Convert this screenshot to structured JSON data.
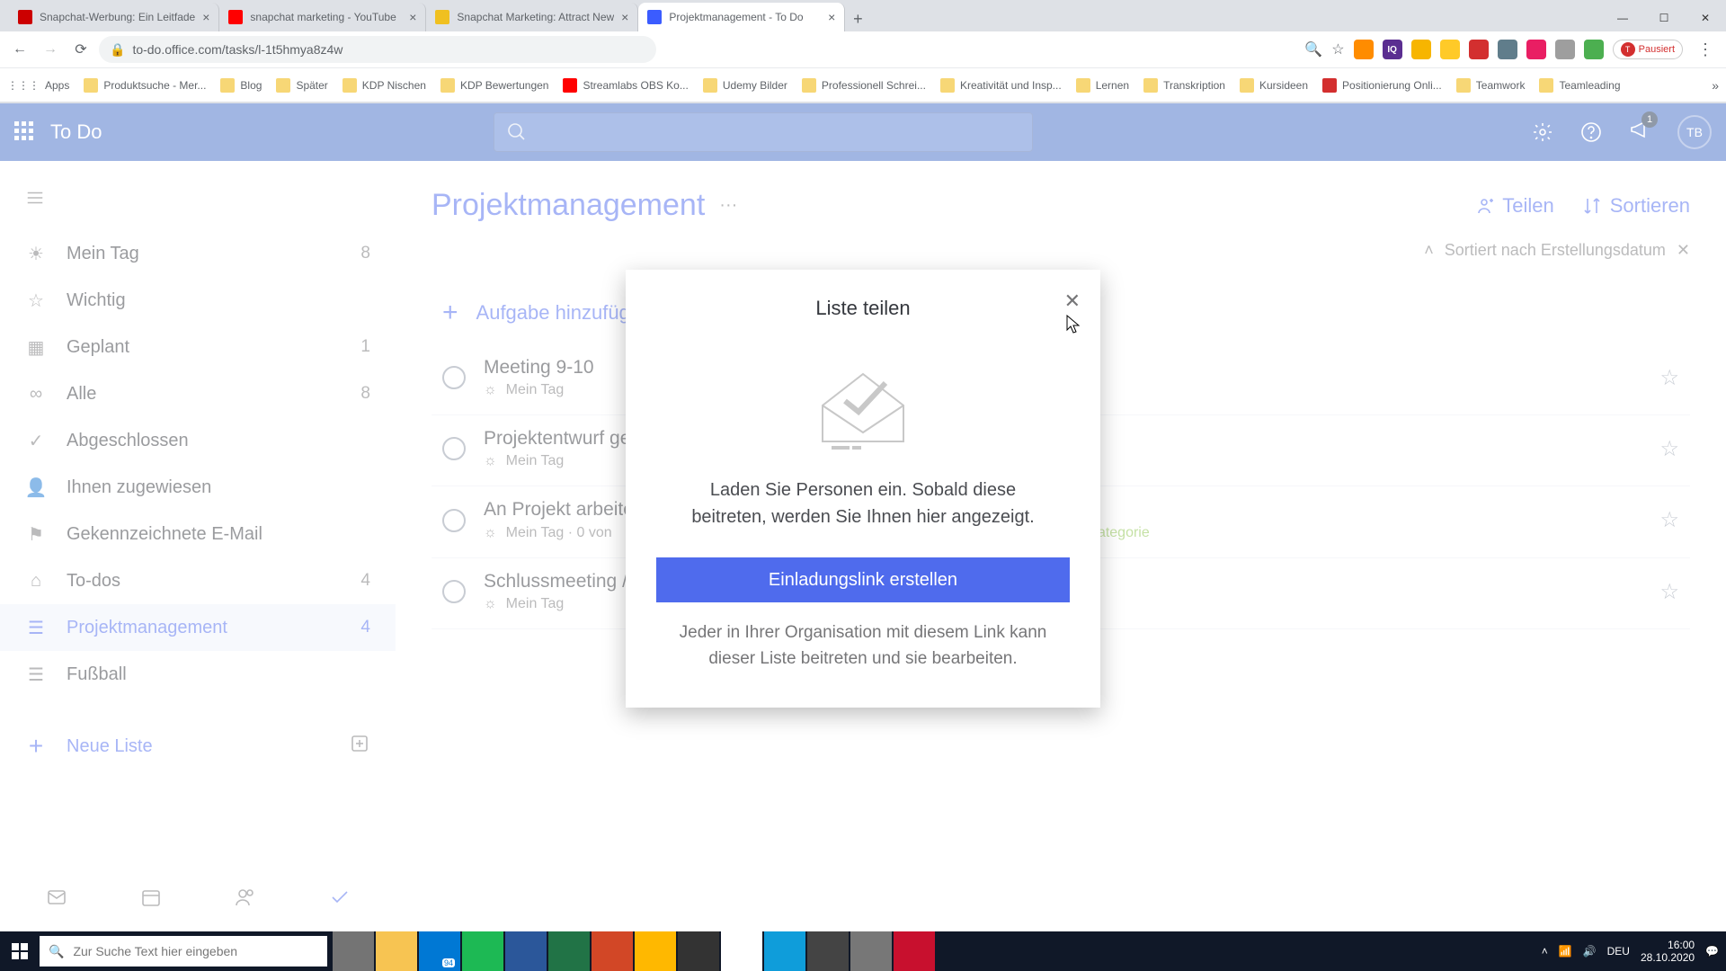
{
  "browser": {
    "tabs": [
      {
        "title": "Snapchat-Werbung: Ein Leitfade"
      },
      {
        "title": "snapchat marketing - YouTube"
      },
      {
        "title": "Snapchat Marketing: Attract New"
      },
      {
        "title": "Projektmanagement - To Do"
      }
    ],
    "url": "to-do.office.com/tasks/l-1t5hmya8z4w",
    "pause_label": "Pausiert",
    "bookmarks": [
      "Apps",
      "Produktsuche - Mer...",
      "Blog",
      "Später",
      "KDP Nischen",
      "KDP Bewertungen",
      "Streamlabs OBS Ko...",
      "Udemy Bilder",
      "Professionell Schrei...",
      "Kreativität und Insp...",
      "Lernen",
      "Transkription",
      "Kursideen",
      "Positionierung Onli...",
      "Teamwork",
      "Teamleading"
    ]
  },
  "app": {
    "title": "To Do",
    "avatar": "TB",
    "notification_count": 1
  },
  "sidebar": {
    "items": [
      {
        "label": "Mein Tag",
        "count": 8
      },
      {
        "label": "Wichtig",
        "count": ""
      },
      {
        "label": "Geplant",
        "count": 1
      },
      {
        "label": "Alle",
        "count": 8
      },
      {
        "label": "Abgeschlossen",
        "count": ""
      },
      {
        "label": "Ihnen zugewiesen",
        "count": ""
      },
      {
        "label": "Gekennzeichnete E-Mail",
        "count": ""
      },
      {
        "label": "To-dos",
        "count": 4
      },
      {
        "label": "Projektmanagement",
        "count": 4
      },
      {
        "label": "Fußball",
        "count": ""
      }
    ],
    "new_list": "Neue Liste"
  },
  "main": {
    "title": "Projektmanagement",
    "share": "Teilen",
    "sort": "Sortieren",
    "sort_label": "Sortiert nach Erstellungsdatum",
    "add_task": "Aufgabe hinzufüg",
    "tasks": [
      {
        "title": "Meeting 9-10",
        "meta": "Mein Tag",
        "extra": ""
      },
      {
        "title": "Projektentwurf ge",
        "meta": "Mein Tag",
        "extra": ""
      },
      {
        "title": "An Projekt arbeite",
        "meta": "Mein Tag  ·  0 von",
        "extra": "üne Kategorie"
      },
      {
        "title": "Schlussmeeting //",
        "meta": "Mein Tag",
        "extra": ""
      }
    ]
  },
  "dialog": {
    "title": "Liste teilen",
    "body": "Laden Sie Personen ein. Sobald diese beitreten, werden Sie Ihnen hier angezeigt.",
    "button": "Einladungslink erstellen",
    "footer": "Jeder in Ihrer Organisation mit diesem Link kann dieser Liste beitreten und sie bearbeiten."
  },
  "taskbar": {
    "search_placeholder": "Zur Suche Text hier eingeben",
    "mail_badge": "94",
    "lang": "DEU",
    "time": "16:00",
    "date": "28.10.2020"
  }
}
